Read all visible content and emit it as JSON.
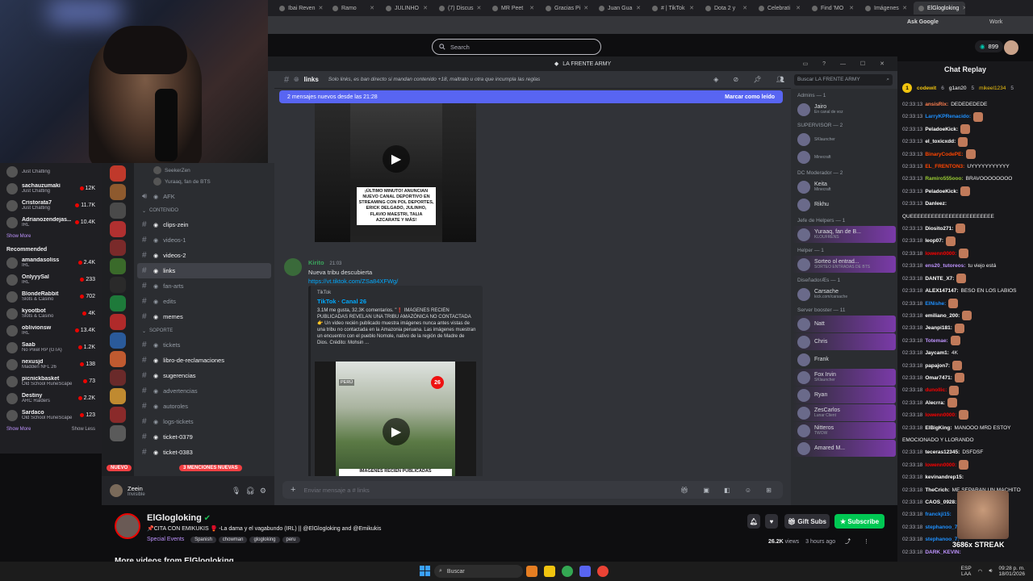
{
  "browser": {
    "tabs": [
      "Ibai Reven",
      "Ramo",
      "JULINHO",
      "(7) Discus",
      "MR Peet",
      "Gracias Pi",
      "Juan Gua",
      "# | TikTok",
      "Dota 2 y",
      "Celebrati",
      "Find 'MO",
      "Imágenes",
      "ElGlogloking"
    ],
    "ask_google": "Ask Google",
    "profile": "Work"
  },
  "twitch": {
    "search_placeholder": "Search",
    "points": "899",
    "followed": [
      {
        "name": "",
        "game": "Just Chatting",
        "viewers": ""
      },
      {
        "name": "sachauzumaki",
        "game": "Just Chatting",
        "viewers": "12K"
      },
      {
        "name": "Cristorata7",
        "game": "Just Chatting",
        "viewers": "11.7K"
      },
      {
        "name": "Adrianozendejas...",
        "game": "IRL",
        "viewers": "10.4K"
      }
    ],
    "show_more": "Show More",
    "recommended_title": "Recommended",
    "recommended": [
      {
        "name": "amandasoliss",
        "game": "IRL",
        "viewers": "2.4K"
      },
      {
        "name": "OnlyyySal",
        "game": "IRL",
        "viewers": "233"
      },
      {
        "name": "BlondeRabbit",
        "game": "Slots & Casino",
        "viewers": "702"
      },
      {
        "name": "kyootbot",
        "game": "Slots & Casino",
        "viewers": "4K"
      },
      {
        "name": "oblivionsw",
        "game": "IRL",
        "viewers": "13.4K"
      },
      {
        "name": "Saab",
        "game": "No Pixel RP (GTA)",
        "viewers": "1.2K"
      },
      {
        "name": "nexusjd",
        "game": "Madden NFL 26",
        "viewers": "138"
      },
      {
        "name": "picnickbasket",
        "game": "Old School RuneScape",
        "viewers": "73"
      },
      {
        "name": "Destiny",
        "game": "ARC Raiders",
        "viewers": "2.2K"
      },
      {
        "name": "Sardaco",
        "game": "Old School RuneScape",
        "viewers": "123"
      }
    ],
    "show_more2": "Show More",
    "show_less": "Show Less"
  },
  "discord": {
    "server_name": "LA FRENTE ARMY",
    "voice_users": [
      "SeekerZen",
      "Yuraaq, fan de BTS"
    ],
    "channels": [
      {
        "name": "AFK",
        "type": "voice"
      },
      {
        "cat": "CONTENIDO"
      },
      {
        "name": "clips-zein",
        "bright": true
      },
      {
        "name": "videos-1"
      },
      {
        "name": "videos-2",
        "bright": true
      },
      {
        "name": "links",
        "selected": true
      },
      {
        "name": "fan-arts"
      },
      {
        "name": "edits"
      },
      {
        "name": "memes",
        "bright": true
      },
      {
        "cat": "SOPORTE"
      },
      {
        "name": "tickets"
      },
      {
        "name": "libro-de-reclamaciones",
        "bright": true
      },
      {
        "name": "sugerencias",
        "bright": true
      },
      {
        "name": "advertencias"
      },
      {
        "name": "autoroles"
      },
      {
        "name": "logs-tickets"
      },
      {
        "name": "ticket-0379",
        "bright": true
      },
      {
        "name": "ticket-0383",
        "bright": true
      }
    ],
    "nuevo_badge": "NUEVO",
    "mentions_badge": "3 MENCIONES NUEVAS",
    "user": {
      "name": "Zeein",
      "status": "Invisible"
    },
    "channel_header": {
      "name": "links",
      "topic": "Solo links, es ban directo si mandan contenido +18, maltrato u otra que incumpla las reglas",
      "search": "Buscar LA FRENTE ARMY"
    },
    "new_messages": "2 mensajes nuevos desde las 21:28",
    "mark_read": "Marcar como leído",
    "video1_caption": "¡ÚLTIMO MINUTO! ANUNCIAN NUEVO CANAL DEPORTIVO EN STREAMING CON POL DEPORTES, ERICK DELGADO, JULINHO, FLAVIO MAESTRI, TALIA AZCARATE Y MÁS!",
    "message": {
      "author": "Kirito",
      "time": "21:03",
      "text": "Nueva tribu descubierta",
      "link": "https://vt.tiktok.com/ZSa84XFWg/",
      "embed": {
        "provider": "TikTok",
        "title": "TikTok · Canal 26",
        "desc": "3.1M me gusta, 32.3K comentarios. \"❗ IMÁGENES RECIÉN PUBLICADAS REVELAN UNA TRIBU AMAZÓNICA NO CONTACTADA 👉 Un video recién publicado muestra imágenes nunca antes vistas de una tribu no contactada en la Amazonia peruana. Las imágenes muestran un encuentro con el pueblo Nomole, nativo de la región de Madre de Dios. Crédito: Mohsin ..."
      },
      "video_badge": "26",
      "video_country": "PERÚ",
      "video_caption": "IMÁGENES RECIÉN PUBLICADAS"
    },
    "input_placeholder": "Enviar mensaje a # links",
    "members": [
      {
        "head": "Admins — 1"
      },
      {
        "name": "Jairo",
        "sub": "En canal de voz"
      },
      {
        "head": "SUPERVISOR — 2"
      },
      {
        "name": "",
        "sub": "SKlauncher"
      },
      {
        "name": "",
        "sub": "Minecraft"
      },
      {
        "head": "DC Moderador — 2"
      },
      {
        "name": "Keita",
        "sub": "Minecraft"
      },
      {
        "name": "Rikhu",
        "sub": ""
      },
      {
        "head": "Jefe de Helpers — 1"
      },
      {
        "name": "Yuraaq, fan de B...",
        "sub": "KLOUFRENS",
        "boost": true
      },
      {
        "head": "Helper — 1"
      },
      {
        "name": "Sorteo ol entrad...",
        "sub": "SORTEO ENTRADAS DE BTS",
        "boost": true
      },
      {
        "head": "DiseñadorÆs — 1"
      },
      {
        "name": "Carsache",
        "sub": "kick.com/carsache"
      },
      {
        "head": "Server booster — 11"
      },
      {
        "name": "Natt",
        "sub": "",
        "boost": true
      },
      {
        "name": "Chris",
        "sub": "",
        "boost": true
      },
      {
        "name": "Frank",
        "sub": ""
      },
      {
        "name": "Fox Irvin",
        "sub": "SKlauncher",
        "boost": true
      },
      {
        "name": "Ryan",
        "sub": "",
        "boost": true
      },
      {
        "name": "ZesCarlos",
        "sub": "Lunar Client",
        "boost": true
      },
      {
        "name": "Nitteros",
        "sub": "TWOW",
        "boost": true
      },
      {
        "name": "Amared M...",
        "sub": "",
        "boost": true
      }
    ]
  },
  "chat": {
    "title": "Chat Replay",
    "top": [
      {
        "rank": "1",
        "name": "codewit",
        "n": "6"
      },
      {
        "name": "g1an20",
        "n": "5"
      },
      {
        "name": "mikeel1234",
        "n": "5"
      }
    ],
    "lines": [
      {
        "t": "02:33:13",
        "u": "ansisRix:",
        "m": "DEDEDEDEDE",
        "c": "#ff7f50"
      },
      {
        "t": "02:33:13",
        "u": "LarryKPRenacido:",
        "m": "",
        "c": "#1e90ff",
        "e": 1
      },
      {
        "t": "02:33:13",
        "u": "PeladoeKick:",
        "m": "",
        "c": "#ffffff",
        "e": 1
      },
      {
        "t": "02:33:13",
        "u": "el_toxicxdd:",
        "m": "",
        "c": "#ffffff",
        "e": 1
      },
      {
        "t": "02:33:13",
        "u": "BinaryCodePE:",
        "m": "",
        "c": "#ff4500",
        "e": 1
      },
      {
        "t": "02:33:13",
        "u": "EL_FRENTON3:",
        "m": "UYYYYYYYYYYY",
        "c": "#ff4500"
      },
      {
        "t": "02:33:13",
        "u": "Ramiro555ooo:",
        "m": "BRAVOOOOOOOO",
        "c": "#9acd32"
      },
      {
        "t": "02:33:13",
        "u": "PeladoeKick:",
        "m": "",
        "c": "#ffffff",
        "e": 1
      },
      {
        "t": "02:33:13",
        "u": "Danleez:",
        "m": "",
        "c": "#ffffff"
      },
      {
        "t": "",
        "u": "",
        "m": "QUEEEEEEEEEEEEEEEEEEEEEEEE",
        "c": "#fff"
      },
      {
        "t": "02:33:13",
        "u": "Diosito271:",
        "m": "",
        "c": "#ffffff",
        "e": 1
      },
      {
        "t": "02:33:18",
        "u": "leop07:",
        "m": "",
        "c": "#ffffff",
        "e": 1
      },
      {
        "t": "02:33:18",
        "u": "lowenn0000:",
        "m": "",
        "c": "#ff0000",
        "e": 1
      },
      {
        "t": "02:33:18",
        "u": "ens20_tutoreos:",
        "m": "tu viejo está",
        "c": "#bf94ff"
      },
      {
        "t": "02:33:18",
        "u": "DANTE_X7:",
        "m": "",
        "c": "#ffffff",
        "e": 1
      },
      {
        "t": "02:33:18",
        "u": "ALEX147147:",
        "m": "BESO EN LOS LABIOS",
        "c": "#ffffff"
      },
      {
        "t": "02:33:18",
        "u": "ElNishe:",
        "m": "",
        "c": "#1e90ff",
        "e": 1
      },
      {
        "t": "02:33:18",
        "u": "emiliano_200:",
        "m": "",
        "c": "#ffffff",
        "e": 1
      },
      {
        "t": "02:33:18",
        "u": "Jeanpi181:",
        "m": "",
        "c": "#ffffff",
        "e": 1
      },
      {
        "t": "02:33:18",
        "u": "Totemae:",
        "m": "",
        "c": "#bf94ff",
        "e": 1
      },
      {
        "t": "02:33:18",
        "u": "Jaycam1:",
        "m": "4K",
        "c": "#ffffff"
      },
      {
        "t": "02:33:18",
        "u": "papajon7:",
        "m": "",
        "c": "#ffffff",
        "e": 1
      },
      {
        "t": "02:33:18",
        "u": "Omar7471:",
        "m": "",
        "c": "#ffffff",
        "e": 1
      },
      {
        "t": "02:33:18",
        "u": "dunollic:",
        "m": "",
        "c": "#ff0000",
        "e": 1
      },
      {
        "t": "02:33:18",
        "u": "Alecrra:",
        "m": "",
        "c": "#ffffff",
        "e": 1
      },
      {
        "t": "02:33:18",
        "u": "lowenn0000:",
        "m": "",
        "c": "#ff0000",
        "e": 1
      },
      {
        "t": "02:33:18",
        "u": "ElBigKing:",
        "m": "MANOOO MRD ESTOY",
        "c": "#ffffff"
      },
      {
        "t": "",
        "u": "",
        "m": "EMOCIONADO Y LLORANDO",
        "c": "#fff"
      },
      {
        "t": "02:33:18",
        "u": "teceras12345:",
        "m": "DSFDSF",
        "c": "#ffffff"
      },
      {
        "t": "02:33:18",
        "u": "lowenn0000:",
        "m": "",
        "c": "#ff0000",
        "e": 1
      },
      {
        "t": "02:33:18",
        "u": "kevinandrep15:",
        "m": "",
        "c": "#ffffff"
      },
      {
        "t": "02:33:18",
        "u": "TheCrich:",
        "m": "ME SEPARAN UN MACHITO",
        "c": "#ffffff"
      },
      {
        "t": "02:33:18",
        "u": "CAOS_0928:",
        "m": "",
        "c": "#ffffff"
      },
      {
        "t": "02:33:18",
        "u": "franckji15:",
        "m": "",
        "c": "#1e90ff"
      },
      {
        "t": "02:33:18",
        "u": "stephanoo_7:",
        "m": "",
        "c": "#1e90ff"
      },
      {
        "t": "02:33:18",
        "u": "stephanoo_7:",
        "m": "",
        "c": "#1e90ff"
      },
      {
        "t": "02:33:18",
        "u": "DARK_KEVIN:",
        "m": "",
        "c": "#bf94ff"
      }
    ],
    "streak": "3686x STREAK"
  },
  "stream": {
    "name": "ElGlogloking",
    "title": "📌CITA CON EMIKUKIS 🥊 -La dama y el vagabundo (IRL) || @ElGlogloking and @Emikukis",
    "category": "Special Events",
    "tags": [
      "Spanish",
      "chowman",
      "glogloking",
      "peru"
    ],
    "gift": "Gift Subs",
    "subscribe": "Subscribe",
    "views": "26.2K",
    "views_label": "views",
    "age": "3 hours ago",
    "more_videos": "More videos from ElGlogloking"
  },
  "taskbar": {
    "search": "Buscar",
    "lang": "ESP",
    "lang2": "LAA",
    "time": "09:28 p. m.",
    "date": "18/01/2026"
  }
}
